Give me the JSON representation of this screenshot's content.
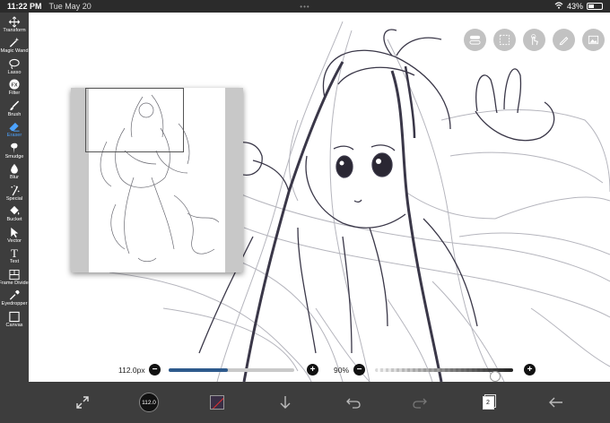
{
  "status": {
    "time": "11:22 PM",
    "date": "Tue May 20",
    "battery": "43%",
    "battery_level": 0.43
  },
  "tools": [
    {
      "name": "transform",
      "label": "Transform",
      "icon": "move-arrows-icon"
    },
    {
      "name": "magic-wand",
      "label": "Magic Wand",
      "icon": "magic-wand-icon"
    },
    {
      "name": "lasso",
      "label": "Lasso",
      "icon": "lasso-icon"
    },
    {
      "name": "filter",
      "label": "Filter",
      "icon": "fx-icon"
    },
    {
      "name": "brush",
      "label": "Brush",
      "icon": "brush-icon"
    },
    {
      "name": "eraser",
      "label": "Eraser",
      "icon": "eraser-icon",
      "active": true
    },
    {
      "name": "smudge",
      "label": "Smudge",
      "icon": "smudge-icon"
    },
    {
      "name": "blur",
      "label": "Blur",
      "icon": "drop-icon"
    },
    {
      "name": "special",
      "label": "Special",
      "icon": "sparkle-icon"
    },
    {
      "name": "bucket",
      "label": "Bucket",
      "icon": "bucket-icon"
    },
    {
      "name": "vector",
      "label": "Vector",
      "icon": "cursor-icon"
    },
    {
      "name": "text",
      "label": "Text",
      "icon": "text-icon"
    },
    {
      "name": "frame-divider",
      "label": "Frame Divider",
      "icon": "frame-divider-icon"
    },
    {
      "name": "eyedropper",
      "label": "Eyedropper",
      "icon": "eyedropper-icon"
    },
    {
      "name": "canvas",
      "label": "Canvas",
      "icon": "canvas-icon"
    }
  ],
  "sliders": {
    "size_label": "112.0px",
    "size_value": 0.47,
    "opacity_label": "90%",
    "opacity_value": 0.9,
    "minus": "−",
    "plus": "+"
  },
  "bottom": {
    "brush_size": "112.0",
    "layer_count": "2",
    "color": "#3a2f45"
  },
  "top_buttons": [
    "layer-toggle-icon",
    "selection-icon",
    "touch-icon",
    "pen-icon",
    "reference-image-icon"
  ],
  "accent": "#4da3ff"
}
